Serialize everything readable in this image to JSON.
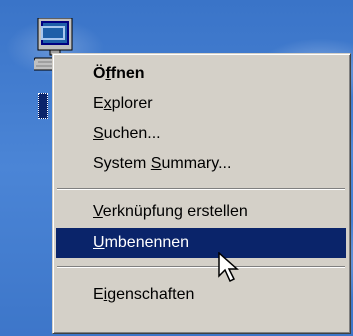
{
  "desktop": {
    "background_color": "#3f78cc",
    "icon": {
      "name": "my-computer-icon"
    }
  },
  "context_menu": {
    "items": [
      {
        "pre": "Ö",
        "u": "f",
        "post": "fnen",
        "bold": true
      },
      {
        "pre": "E",
        "u": "x",
        "post": "plorer"
      },
      {
        "pre": "",
        "u": "S",
        "post": "uchen..."
      },
      {
        "pre": "System ",
        "u": "S",
        "post": "ummary..."
      },
      {
        "pre": "",
        "u": "V",
        "post": "erknüpfung erstellen"
      },
      {
        "pre": "",
        "u": "U",
        "post": "mbenennen",
        "selected": true
      },
      {
        "pre": "E",
        "u": "i",
        "post": "genschaften"
      }
    ],
    "selection_color": "#0a246a"
  },
  "cursor": {
    "name": "arrow-cursor-icon"
  }
}
